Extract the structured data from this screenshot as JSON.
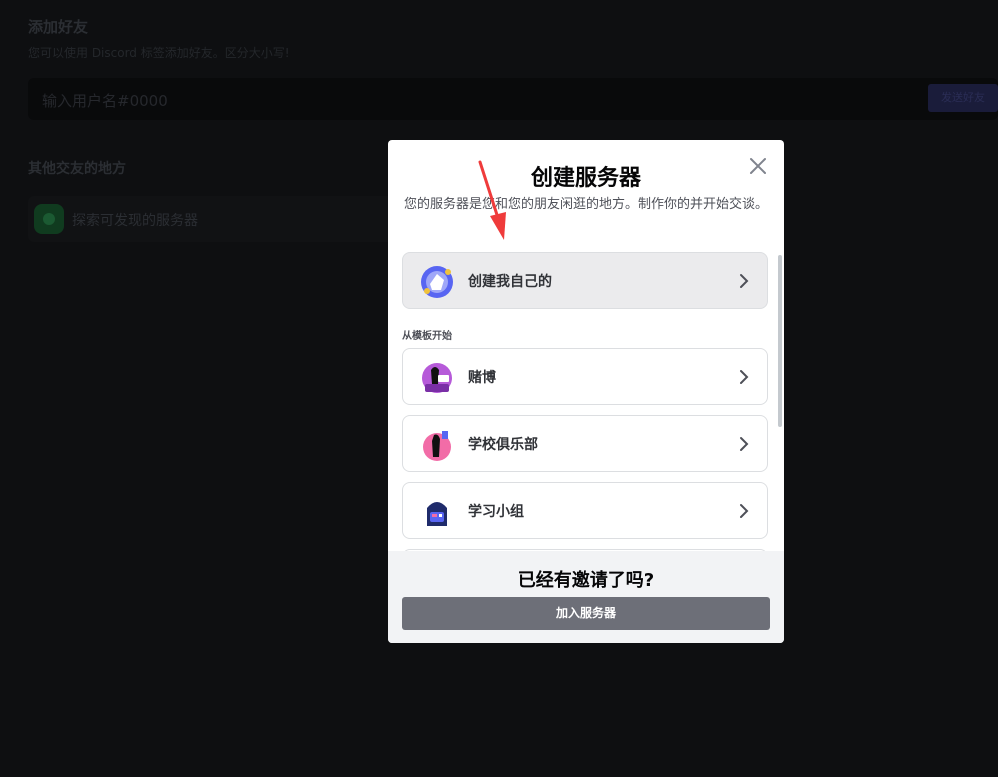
{
  "background": {
    "add_friend_title": "添加好友",
    "add_friend_sub": "您可以使用 Discord 标签添加好友。区分大小写!",
    "username_placeholder": "输入用户名#0000",
    "send_button": "发送好友",
    "other_places_title": "其他交友的地方",
    "explore_servers": "探索可发现的服务器"
  },
  "modal": {
    "title": "创建服务器",
    "description": "您的服务器是您和您的朋友闲逛的地方。制作你的并开始交谈。",
    "create_own": "创建我自己的",
    "template_section": "从模板开始",
    "templates": [
      {
        "label": "赌博",
        "icon": "gaming-icon"
      },
      {
        "label": "学校俱乐部",
        "icon": "school-club-icon"
      },
      {
        "label": "学习小组",
        "icon": "study-group-icon"
      }
    ],
    "footer_title": "已经有邀请了吗?",
    "join_button": "加入服务器"
  },
  "colors": {
    "background": "#0e0f11",
    "join_button": "#6d6f78",
    "arrow": "#ef3b3b"
  }
}
